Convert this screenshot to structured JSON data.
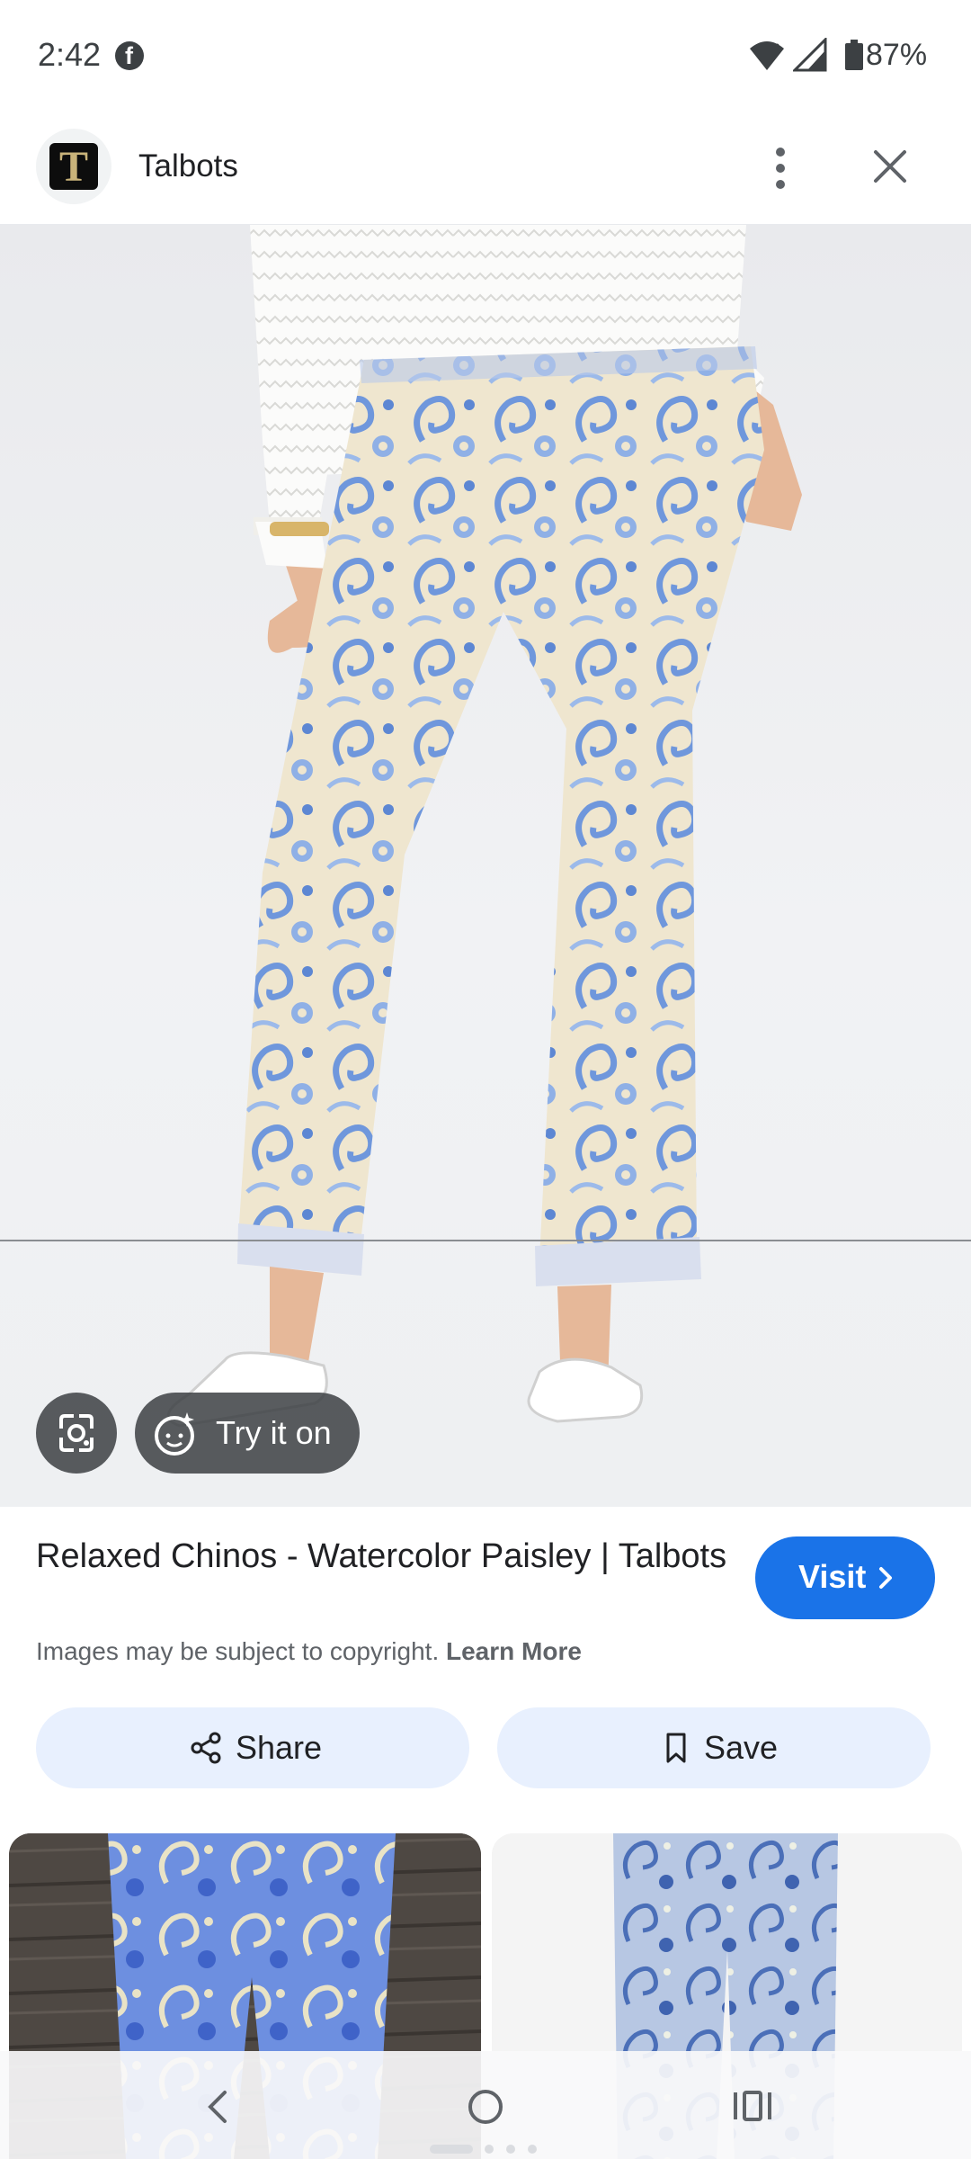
{
  "status": {
    "time": "2:42",
    "battery": "87%",
    "icons": [
      "facebook-icon",
      "wifi-icon",
      "signal-icon",
      "battery-icon"
    ]
  },
  "header": {
    "site_name": "Talbots",
    "logo_letter": "T",
    "icons": [
      "more-vert-icon",
      "close-icon"
    ]
  },
  "image": {
    "try_on_label": "Try it on",
    "icons": [
      "lens-icon",
      "try-on-icon"
    ]
  },
  "result": {
    "title": "Relaxed Chinos - Watercolor Paisley | Talbots",
    "visit_label": "Visit",
    "copyright_text": "Images may be subject to copyright.",
    "learn_more_label": "Learn More"
  },
  "actions": {
    "share_label": "Share",
    "save_label": "Save"
  },
  "colors": {
    "accent": "#1a73e8",
    "button_bg": "#e8f0fe",
    "text_primary": "#202124",
    "text_secondary": "#5f6368",
    "paisley_blue": "#6f97dc",
    "paisley_cream": "#efe6cf"
  }
}
